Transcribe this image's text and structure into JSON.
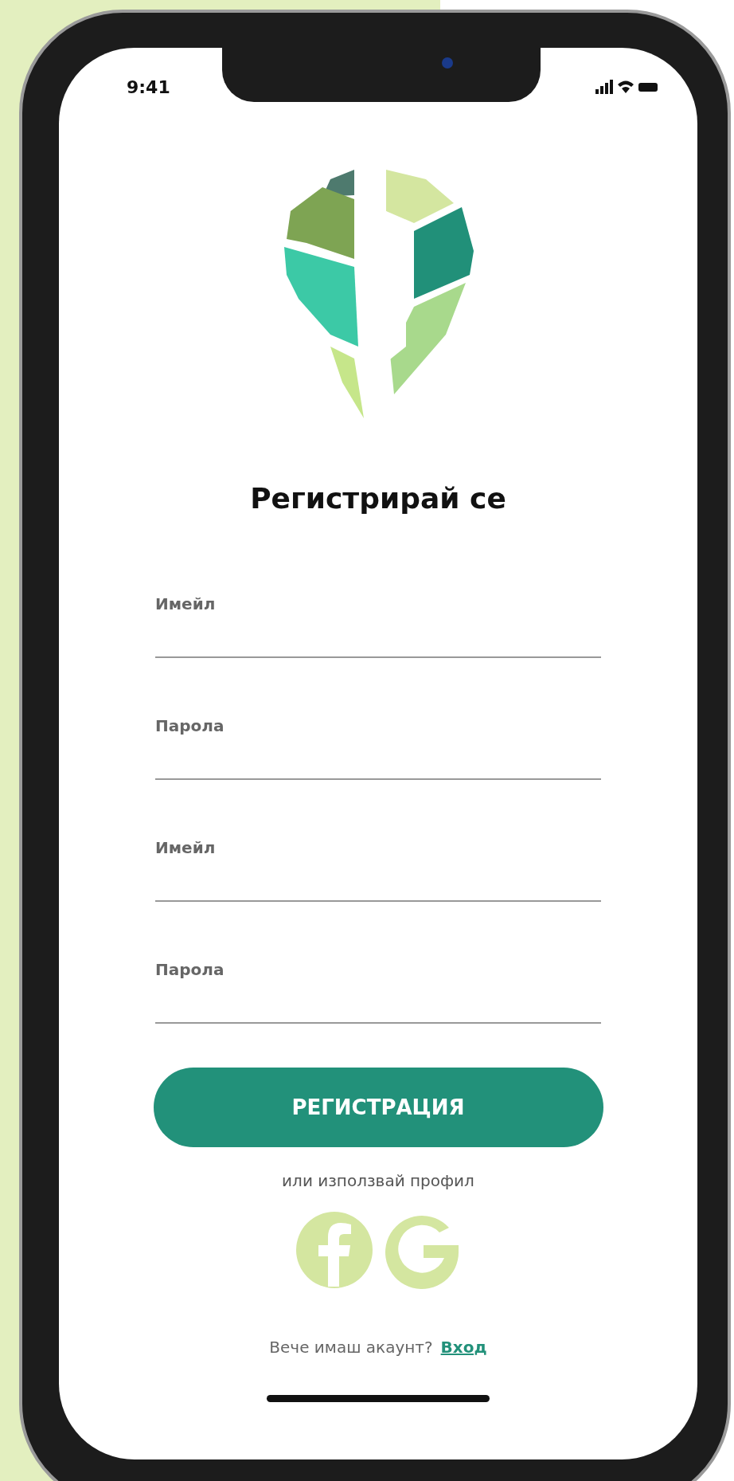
{
  "status_bar": {
    "time": "9:41"
  },
  "title": "Регистрирай се",
  "fields": [
    {
      "label": "Имейл"
    },
    {
      "label": "Парола"
    },
    {
      "label": "Имейл"
    },
    {
      "label": "Парола"
    }
  ],
  "submit_button": "РЕГИСТРАЦИЯ",
  "social_prompt": "или използвай профил",
  "footer": {
    "text": "Вече имаш акаунт?",
    "link": "Вход"
  }
}
